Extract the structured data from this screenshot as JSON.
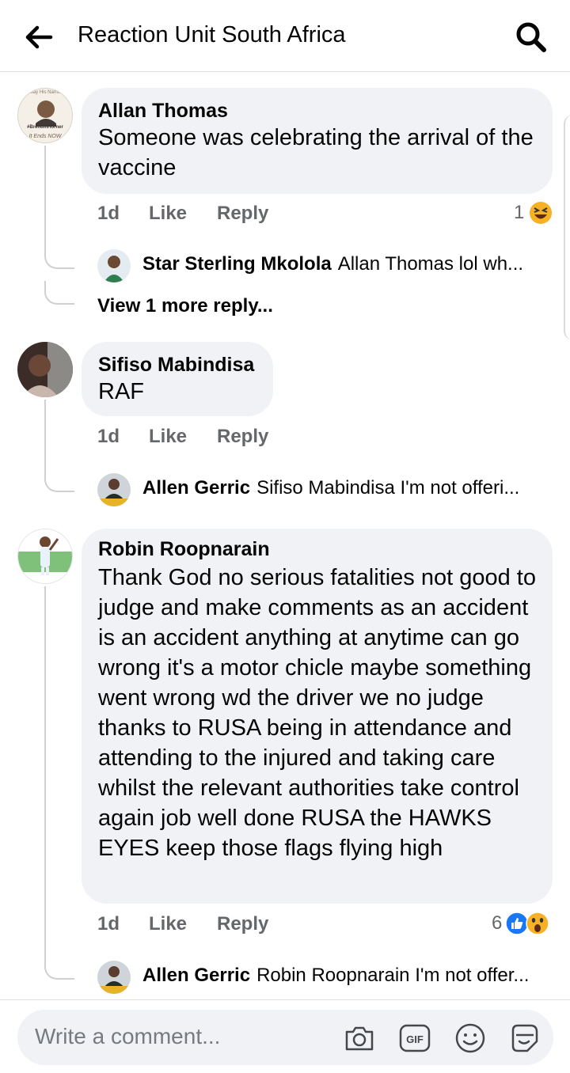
{
  "header": {
    "title": "Reaction Unit South Africa"
  },
  "comments": [
    {
      "author": "Allan Thomas",
      "text": "Someone was celebrating the arrival of the vaccine",
      "avatar_caption_top": "Say His Name",
      "avatar_caption_mid": "#BrendinHorner",
      "avatar_caption_bottom": "It Ends NOW",
      "time": "1d",
      "like": "Like",
      "reply": "Reply",
      "reaction_count": "1",
      "reply_preview": {
        "author": "Star Sterling Mkolola",
        "text": "Allan Thomas lol wh..."
      },
      "view_more": "View 1 more reply..."
    },
    {
      "author": "Sifiso Mabindisa",
      "text": "RAF",
      "time": "1d",
      "like": "Like",
      "reply": "Reply",
      "reply_preview": {
        "author": "Allen Gerric",
        "text": "Sifiso Mabindisa I'm not offeri..."
      }
    },
    {
      "author": "Robin Roopnarain",
      "text": "Thank God no serious fatalities not good to judge and make comments as an accident is an accident anything at anytime can go wrong it's a motor chicle maybe something went wrong wd the driver we no judge thanks to RUSA being in attendance and attending to the injured and taking care whilst the relevant authorities take control again job well done RUSA the HAWKS EYES keep those flags flying high",
      "time": "1d",
      "like": "Like",
      "reply": "Reply",
      "reaction_count": "6",
      "reply_preview": {
        "author": "Allen Gerric",
        "text": "Robin Roopnarain I'm not offer..."
      }
    }
  ],
  "composer": {
    "placeholder": "Write a comment..."
  },
  "icons": {
    "back": "arrow-left-icon",
    "search": "search-icon",
    "camera": "camera-icon",
    "gif": "gif-icon",
    "emoji": "smiley-icon",
    "sticker": "sticker-icon",
    "haha": "haha-reaction-icon",
    "like": "like-reaction-icon",
    "wow": "wow-reaction-icon"
  },
  "colors": {
    "fb_blue": "#1877f2",
    "reaction_yellow": "#f7b125",
    "meta_grey": "#65676b",
    "bubble": "#f0f2f5"
  }
}
